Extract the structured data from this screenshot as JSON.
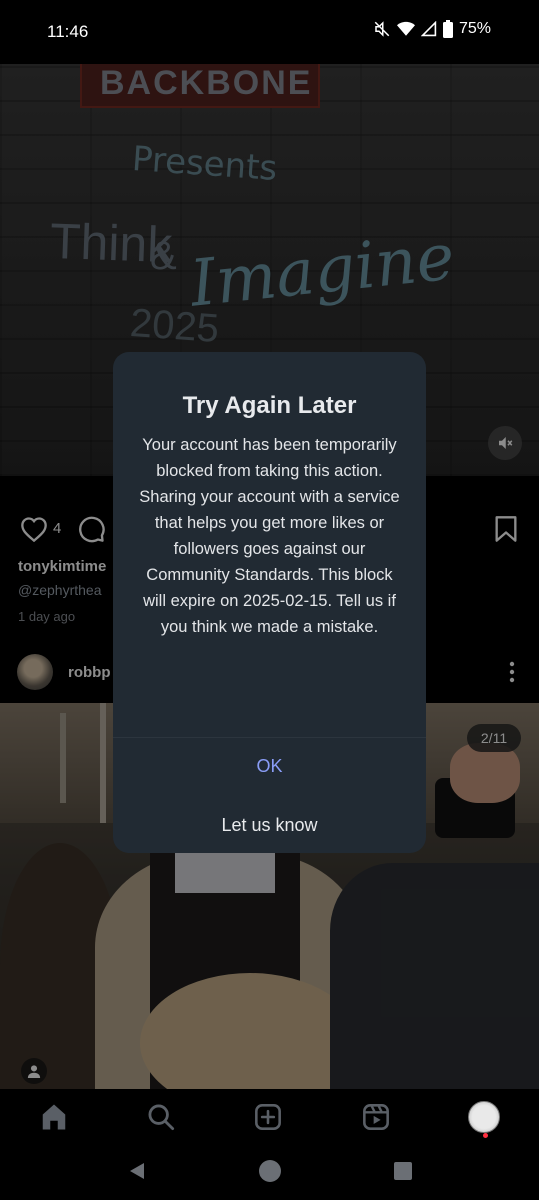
{
  "status_bar": {
    "time": "11:46",
    "battery": "75%",
    "icons": [
      "mute-icon",
      "wifi-icon",
      "signal-icon",
      "battery-icon"
    ]
  },
  "post1": {
    "sign_text": "BACKBONE",
    "wall_text": {
      "presents": "Presents",
      "think": "Think",
      "amp": "&",
      "imagine": "Imagine",
      "year": "2025"
    },
    "like_count": "4",
    "username": "tonykimtime",
    "mention": "@zephyrthea",
    "time_ago": "1 day ago"
  },
  "post2": {
    "username": "robbp",
    "counter": "2/11"
  },
  "dialog": {
    "title": "Try Again Later",
    "message": "Your account has been temporarily blocked from taking this action. Sharing your account with a service that helps you get more likes or followers goes against our Community Standards. This block will expire on 2025-02-15. Tell us if you think we made a mistake.",
    "ok_label": "OK",
    "let_us_know_label": "Let us know"
  },
  "bottom_nav": {
    "items": [
      "home-icon",
      "search-icon",
      "create-icon",
      "reels-icon",
      "profile-avatar"
    ]
  },
  "colors": {
    "dialog_bg": "#212a33",
    "ok_accent": "#8a9df6",
    "notification_dot": "#ff3040"
  }
}
